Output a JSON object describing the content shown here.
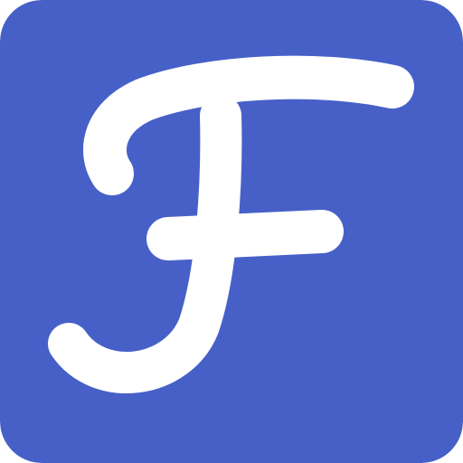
{
  "icon": {
    "name": "f-letter-logo-icon",
    "glyph": "F",
    "background_color": "#4760C8",
    "foreground_color": "#FFFFFF"
  }
}
